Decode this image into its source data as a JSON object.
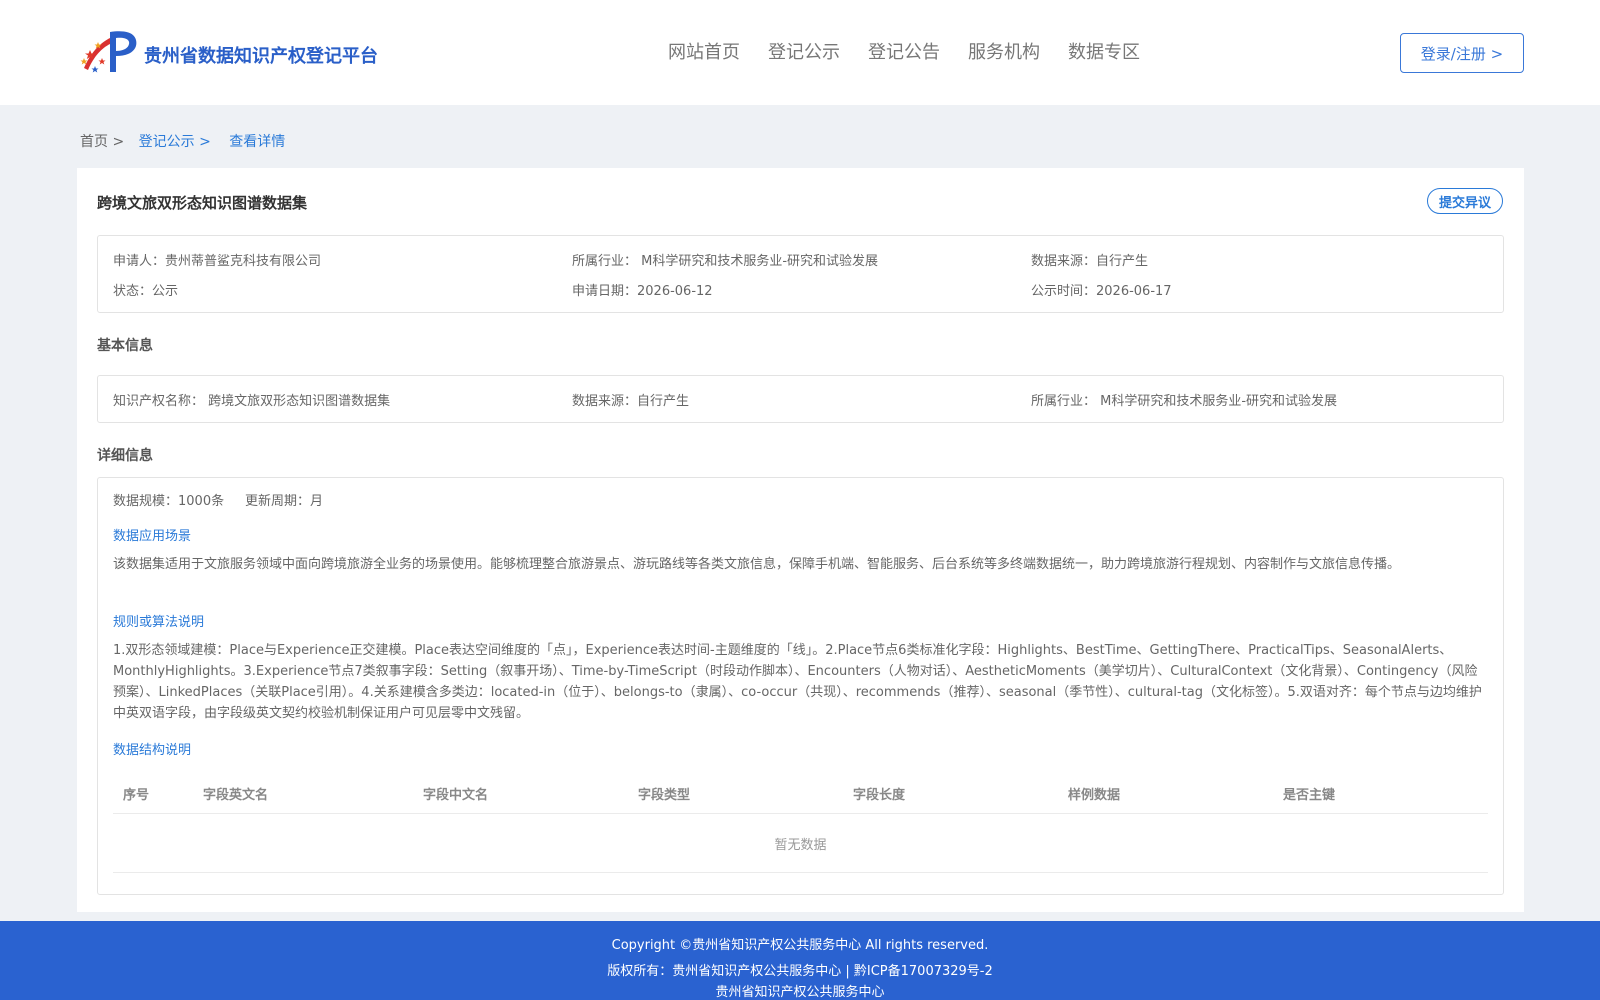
{
  "header": {
    "site_title": "贵州省数据知识产权登记平台",
    "nav": [
      "网站首页",
      "登记公示",
      "登记公告",
      "服务机构",
      "数据专区"
    ],
    "login_label": "登录/注册 >",
    "accent": "#2a5fc8"
  },
  "breadcrumb": {
    "home": "首页 >",
    "list": "登记公示 >",
    "current": "查看详情"
  },
  "dataset": {
    "title": "跨境文旅双形态知识图谱数据集",
    "objection_label": "提交异议"
  },
  "summary": {
    "applicant_label": "申请人：",
    "applicant": "贵州蒂普鲨克科技有限公司",
    "industry_label": "所属行业：",
    "industry": " M科学研究和技术服务业-研究和试验发展",
    "source_label": "数据来源：",
    "source": "自行产生",
    "status_label": "状态：",
    "status": "公示",
    "apply_date_label": "申请日期：",
    "apply_date": "2026-06-12",
    "publish_date_label": "公示时间：",
    "publish_date": "2026-06-17"
  },
  "basic": {
    "section_title": "基本信息",
    "ip_name_label": "知识产权名称：",
    "ip_name": " 跨境文旅双形态知识图谱数据集",
    "source_label": "数据来源：",
    "source": "自行产生",
    "industry_label": "所属行业：",
    "industry": " M科学研究和技术服务业-研究和试验发展"
  },
  "detail": {
    "section_title": "详细信息",
    "scale_label": "数据规模：",
    "scale": "1000条",
    "cycle_label": "更新周期：",
    "cycle": "月",
    "scenario_title": "数据应用场景",
    "scenario_text": "该数据集适用于文旅服务领域中面向跨境旅游全业务的场景使用。能够梳理整合旅游景点、游玩路线等各类文旅信息，保障手机端、智能服务、后台系统等多终端数据统一，助力跨境旅游行程规划、内容制作与文旅信息传播。",
    "rules_title": "规则或算法说明",
    "rules_text": "1.双形态领域建模：Place与Experience正交建模。Place表达空间维度的「点」，Experience表达时间-主题维度的「线」。2.Place节点6类标准化字段：Highlights、BestTime、GettingThere、PracticalTips、SeasonalAlerts、MonthlyHighlights。3.Experience节点7类叙事字段：Setting（叙事开场）、Time-by-TimeScript（时段动作脚本）、Encounters（人物对话）、AestheticMoments（美学切片）、CulturalContext（文化背景）、Contingency（风险预案）、LinkedPlaces（关联Place引用）。4.关系建模含多类边：located-in（位于）、belongs-to（隶属）、co-occur（共现）、recommends（推荐）、seasonal（季节性）、cultural-tag（文化标签）。5.双语对齐：每个节点与边均维护中英双语字段，由字段级英文契约校验机制保证用户可见层零中文残留。",
    "structure_title": "数据结构说明",
    "table_headers": [
      "序号",
      "字段英文名",
      "字段中文名",
      "字段类型",
      "字段长度",
      "样例数据",
      "是否主键"
    ],
    "empty_text": "暂无数据"
  },
  "footer": {
    "line1": "Copyright ©贵州省知识产权公共服务中心 All rights reserved.",
    "line2": "版权所有：贵州省知识产权公共服务中心 | 黔ICP备17007329号-2",
    "line3": "贵州省知识产权公共服务中心"
  }
}
